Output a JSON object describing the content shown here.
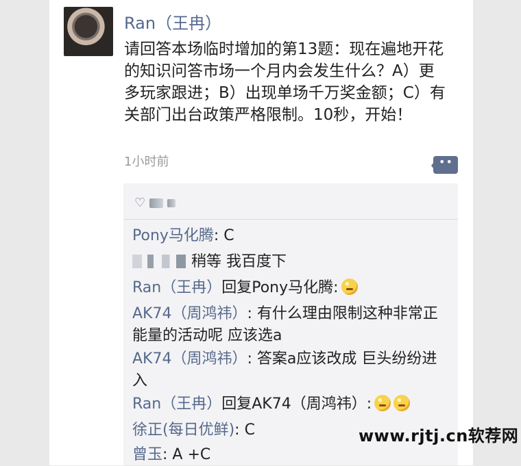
{
  "post": {
    "author": "Ran（王冉）",
    "text": "请回答本场临时增加的第13题：现在遍地开花的知识问答市场一个月内会发生什么？A）更多玩家跟进；B）出现单场千万奖金额；C）有关部门出台政策严格限制。10秒，开始！",
    "time": "1小时前"
  },
  "comments": [
    {
      "name": "Pony马化腾",
      "text": ": C"
    },
    {
      "name": "",
      "text": "稍等 我百度下"
    },
    {
      "name": "Ran（王冉）",
      "text": "回复Pony马化腾:"
    },
    {
      "name": "AK74（周鸿祎）",
      "text": ": 有什么理由限制这种非常正能量的活动呢 应该选a"
    },
    {
      "name": "AK74（周鸿祎）",
      "text": ": 答案a应该改成 巨头纷纷进入"
    },
    {
      "name": "Ran（王冉）",
      "text": "回复AK74（周鸿祎）:"
    },
    {
      "name": "徐正(每日优鲜)",
      "text": ": C"
    },
    {
      "name": "曾玉",
      "text": ": A +C"
    }
  ],
  "watermark": "www.rjtj.cn软荐网",
  "icons": {
    "comment": "comment-icon",
    "like": "heart-icon"
  }
}
